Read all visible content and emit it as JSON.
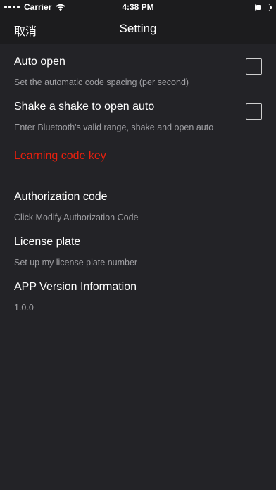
{
  "status": {
    "carrier": "Carrier",
    "time": "4:38 PM"
  },
  "nav": {
    "cancel_label": "取消",
    "title": "Setting"
  },
  "settings": {
    "auto_open": {
      "title": "Auto open",
      "subtitle": "Set the automatic code spacing (per second)",
      "checked": false
    },
    "shake_open": {
      "title": "Shake a shake to open auto",
      "subtitle": "Enter Bluetooth's valid range, shake and open auto",
      "checked": false
    },
    "learning_code_key": {
      "title": "Learning code key",
      "color": "#e8200e"
    },
    "authorization_code": {
      "title": "Authorization code",
      "subtitle": "Click Modify Authorization Code"
    },
    "license_plate": {
      "title": "License plate",
      "subtitle": "Set up my license plate number"
    },
    "app_version": {
      "title": "APP Version Information",
      "subtitle": "1.0.0"
    }
  },
  "colors": {
    "background": "#232327",
    "bar": "#1c1c1e",
    "subtitle": "#a0a0a4",
    "accent_red": "#e8200e"
  }
}
